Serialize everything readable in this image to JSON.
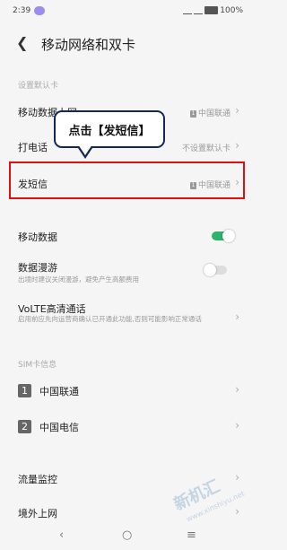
{
  "status": {
    "time": "2:39",
    "battery": "100%"
  },
  "header": {
    "title": "移动网络和双卡"
  },
  "default_card": {
    "section": "设置默认卡",
    "mobile_data": {
      "label": "移动数据上网",
      "value": "中国联通"
    },
    "call": {
      "label": "打电话",
      "value": "不设置默认卡"
    },
    "sms": {
      "label": "发短信",
      "value": "中国联通"
    }
  },
  "sim_tag": "1",
  "callout": {
    "text": "点击【发短信】"
  },
  "mobile_data_toggle": {
    "label": "移动数据",
    "on": true
  },
  "roaming": {
    "label": "数据漫游",
    "desc": "出境时建议关闭漫游，避免产生高额费用",
    "on": false
  },
  "volte": {
    "label": "VoLTE高清通话",
    "desc": "启用前应先向运营商确认已开通此功能,否则可能影响正常通话"
  },
  "sim_info": {
    "section": "SIM卡信息",
    "sim1": {
      "index": "1",
      "name": "中国联通"
    },
    "sim2": {
      "index": "2",
      "name": "中国电信"
    }
  },
  "traffic": {
    "label": "流量监控"
  },
  "overseas": {
    "label": "境外上网"
  },
  "colors": {
    "accent": "#2db36b",
    "highlight": "#e01010",
    "callout_border": "#14294f"
  },
  "watermark": {
    "text": "新机汇",
    "sub": "www.xinshiyu.net"
  }
}
